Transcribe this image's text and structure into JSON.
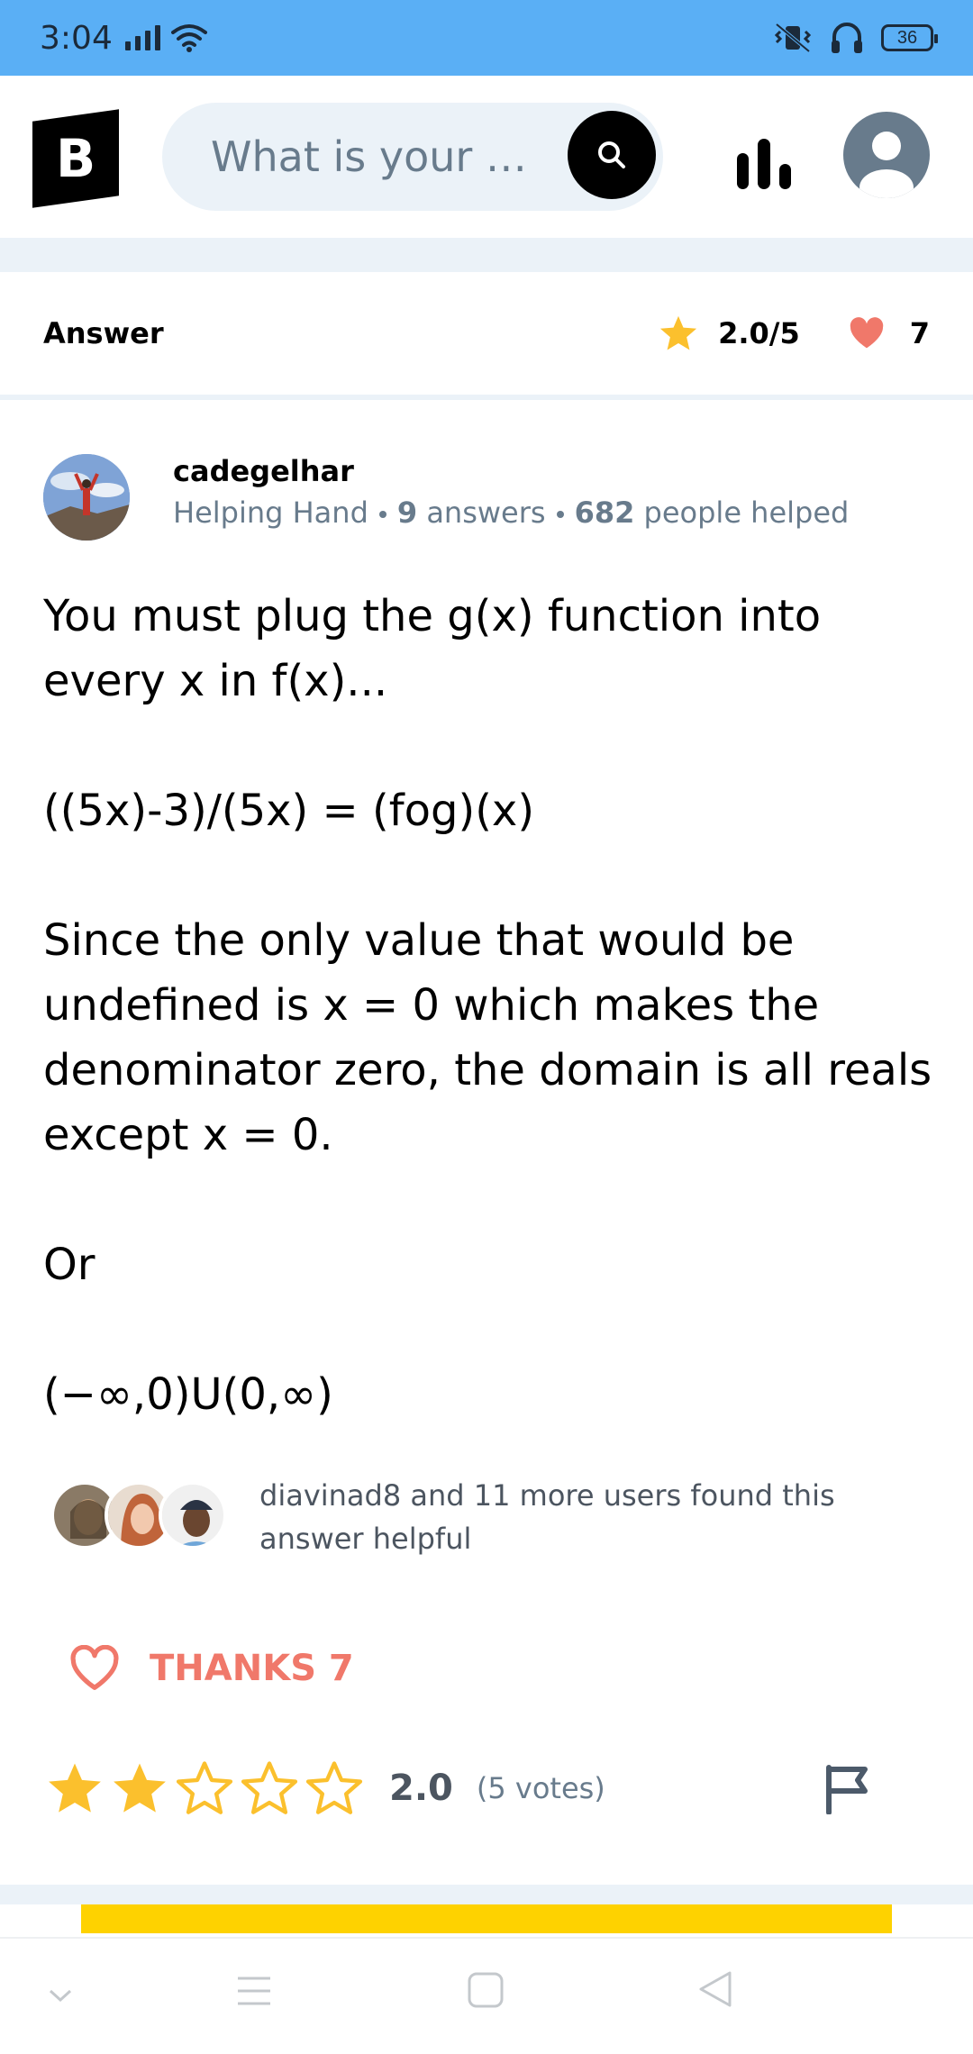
{
  "status_bar": {
    "time": "3:04",
    "battery": "36"
  },
  "header": {
    "logo_letter": "B",
    "search_placeholder": "What is your qu..."
  },
  "answer_header": {
    "title": "Answer",
    "rating": "2.0/5",
    "thanks_count": "7"
  },
  "author": {
    "name": "cadegelhar",
    "rank": "Helping Hand",
    "answers_count": "9",
    "answers_label": "answers",
    "helped_count": "682",
    "helped_label": "people helped"
  },
  "answer": {
    "paragraphs": [
      "You must plug the g(x) function into every x in f(x)...",
      "((5x)-3)/(5x) = (fog)(x)",
      "Since the only value that would be undefined is x = 0 which makes the denominator zero, the domain is all reals except x = 0.",
      "Or",
      "(−∞,0)U(0,∞)"
    ]
  },
  "helpful": {
    "text": "diavinad8 and 11 more users found this answer helpful"
  },
  "thanks": {
    "label": "THANKS 7"
  },
  "rating": {
    "value": "2.0",
    "votes": "(5 votes)",
    "stars_filled": 2,
    "stars_total": 5
  },
  "colors": {
    "status_bar": "#5aaff5",
    "accent_red": "#f0786a",
    "star_yellow": "#fbc02d",
    "band": "#ebf2f8",
    "gray_text": "#687b8c",
    "yellow_cta": "#fed200"
  },
  "icons": [
    "signal-icon",
    "wifi-icon",
    "vibrate-icon",
    "headphones-icon",
    "battery-icon",
    "search-icon",
    "stats-icon",
    "profile-icon",
    "star-icon",
    "heart-icon",
    "flag-icon",
    "nav-down-icon",
    "nav-menu-icon",
    "nav-home-icon",
    "nav-back-icon"
  ]
}
